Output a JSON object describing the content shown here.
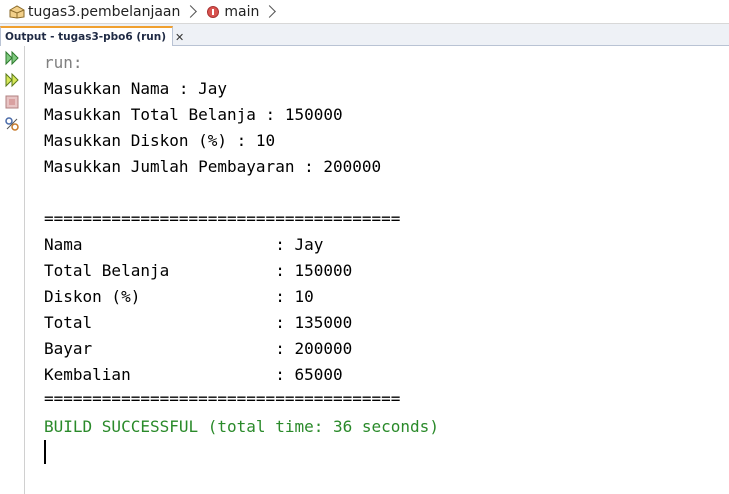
{
  "breadcrumb": {
    "items": [
      {
        "label": "tugas3.pembelanjaan",
        "icon": "package-icon"
      },
      {
        "label": "main",
        "icon": "method-icon"
      }
    ]
  },
  "output_tab": {
    "label": "Output - tugas3-pbo6 (run)",
    "close_glyph": "✕"
  },
  "toolbar": {
    "buttons": [
      "rerun-icon",
      "rerun-with-params-icon",
      "stop-icon",
      "settings-icon"
    ]
  },
  "console": {
    "lines": [
      "run:",
      "Masukkan Nama : Jay",
      "Masukkan Total Belanja : 150000",
      "Masukkan Diskon (%) : 10",
      "Masukkan Jumlah Pembayaran : 200000",
      "",
      "=====================================",
      "Nama                    : Jay",
      "Total Belanja           : 150000",
      "Diskon (%)              : 10",
      "Total                   : 135000",
      "Bayar                   : 200000",
      "Kembalian               : 65000",
      "=====================================",
      "BUILD SUCCESSFUL (total time: 36 seconds)"
    ]
  },
  "colors": {
    "run_text": "#808080",
    "build_success": "#2a8a2a",
    "tab_accent": "#f0a030"
  }
}
